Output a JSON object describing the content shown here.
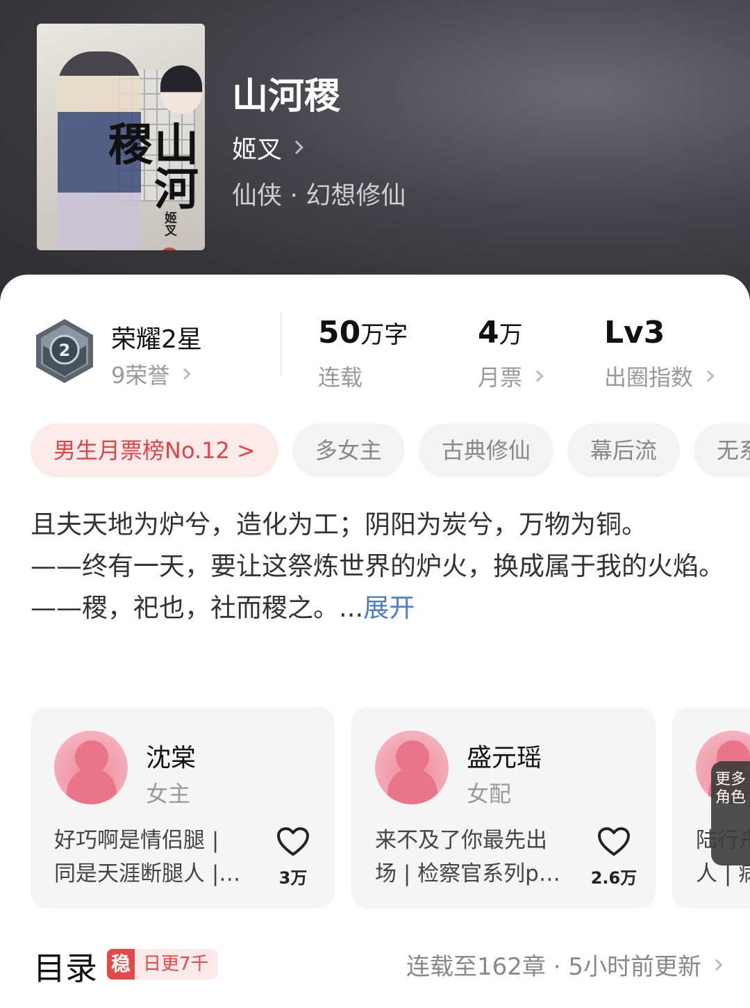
{
  "book": {
    "title": "山河稷",
    "author": "姬叉",
    "genre": "仙侠 · 幻想修仙",
    "cover": {
      "title": "山河稷",
      "author": "姬叉",
      "seal": "著"
    }
  },
  "stats": {
    "honor": {
      "title": "荣耀2星",
      "sub": "9荣誉"
    },
    "words": {
      "num": "50",
      "unit": "万字",
      "label": "连载"
    },
    "tickets": {
      "num": "4",
      "unit": "万",
      "label": "月票"
    },
    "index": {
      "num": "Lv3",
      "label": "出圈指数"
    }
  },
  "tags": [
    "男生月票榜No.12 >",
    "多女主",
    "古典修仙",
    "幕后流",
    "无系统"
  ],
  "description": {
    "lines": [
      "且夫天地为炉兮，造化为工；阴阳为炭兮，万物为铜。",
      "——终有一天，要让这祭炼世界的炉火，换成属于我的火焰。",
      "——稷，祀也，社而稷之。..."
    ],
    "expand": "展开"
  },
  "characters": [
    {
      "name": "沈棠",
      "role": "女主",
      "desc1": "好巧啊是情侣腿 |",
      "desc2": "同是天涯断腿人 |…",
      "likes": "3万"
    },
    {
      "name": "盛元瑶",
      "role": "女配",
      "desc1": "来不及了你最先出",
      "desc2": "场 | 检察官系列p…",
      "likes": "2.6万"
    },
    {
      "name": "",
      "role": "",
      "desc1": "陆行舟",
      "desc2": "人 | 病",
      "likes": ""
    }
  ],
  "more_roles": "更多角色",
  "toc": {
    "title": "目录",
    "badge_icon": "稳",
    "badge_text": "日更7千",
    "status": "连载至162章 · 5小时前更新"
  },
  "colors": {
    "accent": "#e54848",
    "link": "#4d7cc7",
    "pink": "#f08a9c"
  }
}
